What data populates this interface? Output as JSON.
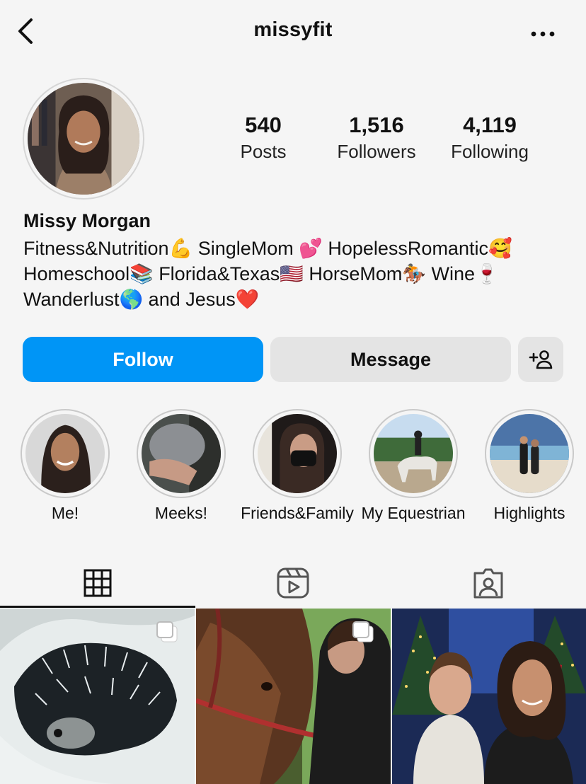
{
  "header": {
    "username": "missyfit",
    "back_icon": "chevron-left-icon",
    "more_icon": "ellipsis-icon"
  },
  "profile": {
    "name": "Missy Morgan",
    "bio_lines": [
      "Fitness&Nutrition💪 SingleMom 💕 HopelessRomantic🥰",
      "Homeschool📚 Florida&Texas🇺🇸 HorseMom🏇 Wine🍷",
      "Wanderlust🌎 and Jesus❤️"
    ]
  },
  "stats": {
    "posts": {
      "value": "540",
      "label": "Posts"
    },
    "followers": {
      "value": "1,516",
      "label": "Followers"
    },
    "following": {
      "value": "4,119",
      "label": "Following"
    }
  },
  "actions": {
    "follow_label": "Follow",
    "message_label": "Message",
    "add_user_icon": "add-user-icon",
    "follow_color": "#0095f6"
  },
  "highlights": [
    {
      "label": "Me!"
    },
    {
      "label": "Meeks!"
    },
    {
      "label": "Friends&Family"
    },
    {
      "label": "My Equestrian"
    },
    {
      "label": "Highlights"
    }
  ],
  "tabs": [
    {
      "icon": "grid-icon",
      "active": true
    },
    {
      "icon": "reels-icon",
      "active": false
    },
    {
      "icon": "tagged-icon",
      "active": false
    }
  ]
}
